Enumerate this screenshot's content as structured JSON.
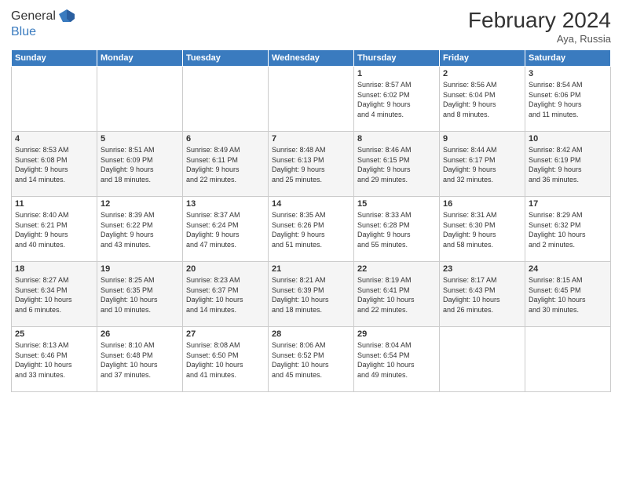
{
  "header": {
    "logo": {
      "line1": "General",
      "line2": "Blue"
    },
    "title": "February 2024",
    "location": "Aya, Russia"
  },
  "calendar": {
    "days_of_week": [
      "Sunday",
      "Monday",
      "Tuesday",
      "Wednesday",
      "Thursday",
      "Friday",
      "Saturday"
    ],
    "weeks": [
      [
        {
          "day": "",
          "info": ""
        },
        {
          "day": "",
          "info": ""
        },
        {
          "day": "",
          "info": ""
        },
        {
          "day": "",
          "info": ""
        },
        {
          "day": "1",
          "info": "Sunrise: 8:57 AM\nSunset: 6:02 PM\nDaylight: 9 hours\nand 4 minutes."
        },
        {
          "day": "2",
          "info": "Sunrise: 8:56 AM\nSunset: 6:04 PM\nDaylight: 9 hours\nand 8 minutes."
        },
        {
          "day": "3",
          "info": "Sunrise: 8:54 AM\nSunset: 6:06 PM\nDaylight: 9 hours\nand 11 minutes."
        }
      ],
      [
        {
          "day": "4",
          "info": "Sunrise: 8:53 AM\nSunset: 6:08 PM\nDaylight: 9 hours\nand 14 minutes."
        },
        {
          "day": "5",
          "info": "Sunrise: 8:51 AM\nSunset: 6:09 PM\nDaylight: 9 hours\nand 18 minutes."
        },
        {
          "day": "6",
          "info": "Sunrise: 8:49 AM\nSunset: 6:11 PM\nDaylight: 9 hours\nand 22 minutes."
        },
        {
          "day": "7",
          "info": "Sunrise: 8:48 AM\nSunset: 6:13 PM\nDaylight: 9 hours\nand 25 minutes."
        },
        {
          "day": "8",
          "info": "Sunrise: 8:46 AM\nSunset: 6:15 PM\nDaylight: 9 hours\nand 29 minutes."
        },
        {
          "day": "9",
          "info": "Sunrise: 8:44 AM\nSunset: 6:17 PM\nDaylight: 9 hours\nand 32 minutes."
        },
        {
          "day": "10",
          "info": "Sunrise: 8:42 AM\nSunset: 6:19 PM\nDaylight: 9 hours\nand 36 minutes."
        }
      ],
      [
        {
          "day": "11",
          "info": "Sunrise: 8:40 AM\nSunset: 6:21 PM\nDaylight: 9 hours\nand 40 minutes."
        },
        {
          "day": "12",
          "info": "Sunrise: 8:39 AM\nSunset: 6:22 PM\nDaylight: 9 hours\nand 43 minutes."
        },
        {
          "day": "13",
          "info": "Sunrise: 8:37 AM\nSunset: 6:24 PM\nDaylight: 9 hours\nand 47 minutes."
        },
        {
          "day": "14",
          "info": "Sunrise: 8:35 AM\nSunset: 6:26 PM\nDaylight: 9 hours\nand 51 minutes."
        },
        {
          "day": "15",
          "info": "Sunrise: 8:33 AM\nSunset: 6:28 PM\nDaylight: 9 hours\nand 55 minutes."
        },
        {
          "day": "16",
          "info": "Sunrise: 8:31 AM\nSunset: 6:30 PM\nDaylight: 9 hours\nand 58 minutes."
        },
        {
          "day": "17",
          "info": "Sunrise: 8:29 AM\nSunset: 6:32 PM\nDaylight: 10 hours\nand 2 minutes."
        }
      ],
      [
        {
          "day": "18",
          "info": "Sunrise: 8:27 AM\nSunset: 6:34 PM\nDaylight: 10 hours\nand 6 minutes."
        },
        {
          "day": "19",
          "info": "Sunrise: 8:25 AM\nSunset: 6:35 PM\nDaylight: 10 hours\nand 10 minutes."
        },
        {
          "day": "20",
          "info": "Sunrise: 8:23 AM\nSunset: 6:37 PM\nDaylight: 10 hours\nand 14 minutes."
        },
        {
          "day": "21",
          "info": "Sunrise: 8:21 AM\nSunset: 6:39 PM\nDaylight: 10 hours\nand 18 minutes."
        },
        {
          "day": "22",
          "info": "Sunrise: 8:19 AM\nSunset: 6:41 PM\nDaylight: 10 hours\nand 22 minutes."
        },
        {
          "day": "23",
          "info": "Sunrise: 8:17 AM\nSunset: 6:43 PM\nDaylight: 10 hours\nand 26 minutes."
        },
        {
          "day": "24",
          "info": "Sunrise: 8:15 AM\nSunset: 6:45 PM\nDaylight: 10 hours\nand 30 minutes."
        }
      ],
      [
        {
          "day": "25",
          "info": "Sunrise: 8:13 AM\nSunset: 6:46 PM\nDaylight: 10 hours\nand 33 minutes."
        },
        {
          "day": "26",
          "info": "Sunrise: 8:10 AM\nSunset: 6:48 PM\nDaylight: 10 hours\nand 37 minutes."
        },
        {
          "day": "27",
          "info": "Sunrise: 8:08 AM\nSunset: 6:50 PM\nDaylight: 10 hours\nand 41 minutes."
        },
        {
          "day": "28",
          "info": "Sunrise: 8:06 AM\nSunset: 6:52 PM\nDaylight: 10 hours\nand 45 minutes."
        },
        {
          "day": "29",
          "info": "Sunrise: 8:04 AM\nSunset: 6:54 PM\nDaylight: 10 hours\nand 49 minutes."
        },
        {
          "day": "",
          "info": ""
        },
        {
          "day": "",
          "info": ""
        }
      ]
    ]
  }
}
